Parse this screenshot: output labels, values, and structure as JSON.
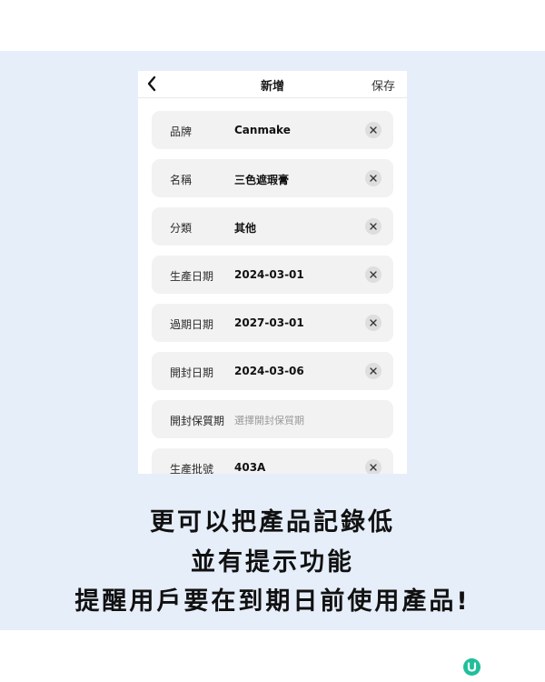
{
  "nav": {
    "title": "新增",
    "save_label": "保存"
  },
  "fields": [
    {
      "label": "品牌",
      "value": "Canmake"
    },
    {
      "label": "名稱",
      "value": "三色遮瑕膏"
    },
    {
      "label": "分類",
      "value": "其他"
    },
    {
      "label": "生產日期",
      "value": "2024-03-01"
    },
    {
      "label": "過期日期",
      "value": "2027-03-01"
    },
    {
      "label": "開封日期",
      "value": "2024-03-06"
    },
    {
      "label": "開封保質期",
      "placeholder": "選擇開封保質期"
    },
    {
      "label": "生產批號",
      "value": "403A"
    }
  ],
  "caption": {
    "line1": "更可以把產品記錄低",
    "line2": "並有提示功能",
    "line3": "提醒用戶要在到期日前使用產品!"
  },
  "icons": {
    "back": "chevron-left-icon",
    "clear": "close-icon",
    "logo": "u-logo-icon"
  },
  "colors": {
    "band": "#e6eefa",
    "logo": "#1fbf9a"
  }
}
